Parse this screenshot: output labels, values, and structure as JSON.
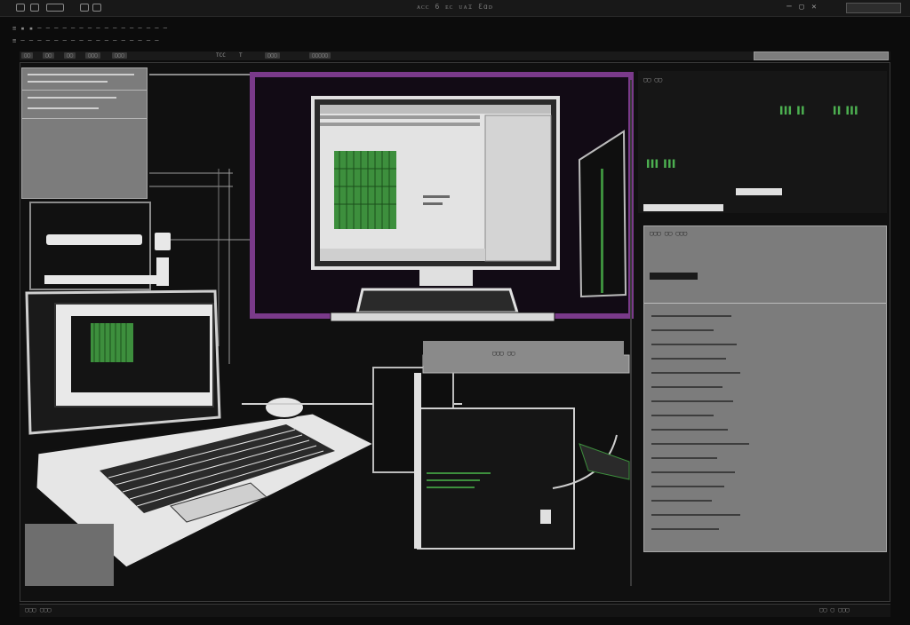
{
  "titlebar": {
    "title": "ᴀᴄᴄ 6 ᴇᴄ ᴜᴀɪ Ɛɑᴅ"
  },
  "menu": {
    "row1": "≡ ▪ ▪ ─ ─ ─ ─ ─ ─ ─ ─ ─ ─ ─ ─ ─ ─ ─ ─",
    "row2": "≡ ─ ─ ─ ─ ─ ─ ─ ─ ─ ─ ─ ─ ─ ─ ─ ─ ─"
  },
  "toolbar": {
    "items": [
      "▢▢",
      "▢▢",
      "▢▢",
      "▢▢▢",
      "▢▢▢",
      "TCC",
      "T",
      "▢▢▢",
      "▢▢▢▢▢"
    ]
  },
  "right_panel": {
    "title": "▢▢ ▢▢",
    "green_rows": [
      "▌▌▌ ▌▌",
      "▌▌ ▌▌▌",
      "▌▌▌ ▌▌▌"
    ],
    "list_header": "▢▢▢ ▢▢ ▢▢▢"
  },
  "inner_screen": {
    "label": "▢▢▢ ▢▢"
  },
  "status": {
    "left": "▢▢▢ ▢▢▢",
    "right": "▢▢ ▢ ▢▢▢"
  },
  "colors": {
    "accent": "#7a3a8a",
    "green": "#3d8f3d",
    "panel": "#7c7c7c"
  }
}
